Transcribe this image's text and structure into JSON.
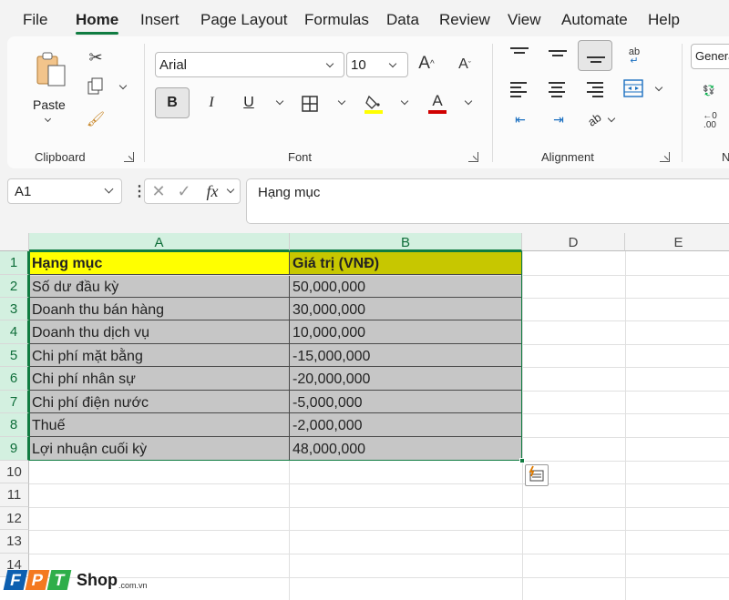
{
  "menu": {
    "tabs": [
      "File",
      "Home",
      "Insert",
      "Page Layout",
      "Formulas",
      "Data",
      "Review",
      "View",
      "Automate",
      "Help"
    ],
    "active": "Home"
  },
  "ribbon": {
    "clipboard": {
      "label": "Clipboard",
      "paste_label": "Paste"
    },
    "font": {
      "label": "Font",
      "font_name": "Arial",
      "font_size": "10",
      "bold": "B",
      "italic": "I",
      "underline": "U",
      "grow": "A",
      "shrink": "A",
      "font_color_letter": "A"
    },
    "alignment": {
      "label": "Alignment"
    },
    "number": {
      "format": "General",
      "label_partial": "N"
    }
  },
  "formula_bar": {
    "name_box": "A1",
    "fx": "fx",
    "content": "Hạng mục"
  },
  "columns": [
    "A",
    "B",
    "D",
    "E"
  ],
  "rows": [
    "1",
    "2",
    "3",
    "4",
    "5",
    "6",
    "7",
    "8",
    "9",
    "10",
    "11",
    "12",
    "13",
    "14"
  ],
  "table": {
    "header": [
      "Hạng mục",
      "Giá trị (VNĐ)"
    ],
    "rows": [
      [
        "Số dư đầu kỳ",
        "50,000,000"
      ],
      [
        "Doanh thu bán hàng",
        "30,000,000"
      ],
      [
        "Doanh thu dịch vụ",
        "10,000,000"
      ],
      [
        "Chi phí mặt bằng",
        "-15,000,000"
      ],
      [
        "Chi phí nhân sự",
        "-20,000,000"
      ],
      [
        "Chi phí điện nước",
        "-5,000,000"
      ],
      [
        "Thuế",
        "-2,000,000"
      ],
      [
        "Lợi nhuận cuối kỳ",
        "48,000,000"
      ]
    ]
  },
  "colors": {
    "accent": "#107c41",
    "header_a_fill": "#ffff00",
    "header_b_fill": "#c7c700",
    "data_fill": "#c6c6c6"
  },
  "watermark": {
    "brand_letters": [
      "F",
      "P",
      "T"
    ],
    "brand_colors": [
      "#0d5fb0",
      "#f47920",
      "#2fae4a"
    ],
    "shop": "Shop",
    "domain": ".com.vn"
  }
}
